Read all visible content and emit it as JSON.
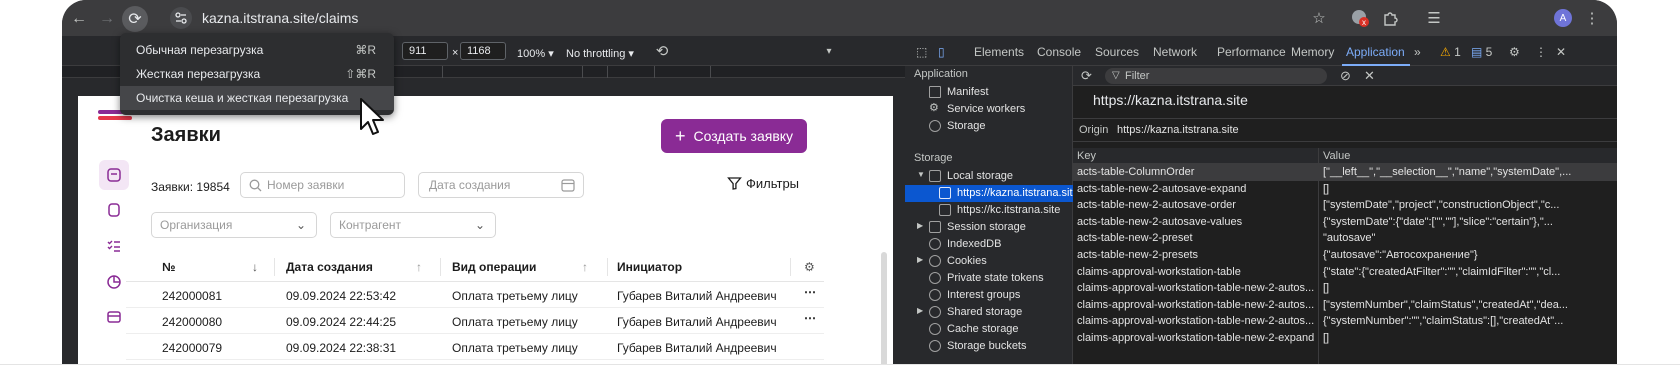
{
  "browser": {
    "url": "kazna.itstrana.site/claims",
    "avatar_letter": "A",
    "badge_count": "x"
  },
  "device_toolbar": {
    "width": "911",
    "times": "×",
    "height": "1168",
    "zoom": "100%",
    "throttling": "No throttling"
  },
  "reload_menu": {
    "items": [
      {
        "label": "Обычная перезагрузка",
        "shortcut": "⌘R"
      },
      {
        "label": "Жесткая перезагрузка",
        "shortcut": "⇧⌘R"
      },
      {
        "label": "Очистка кеша и жесткая перезагрузка",
        "shortcut": ""
      }
    ]
  },
  "page": {
    "title": "Заявки",
    "create_button": "Создать заявку",
    "create_plus": "+",
    "count_label": "Заявки: 19854",
    "search_placeholder": "Номер заявки",
    "date_placeholder": "Дата создания",
    "filters_label": "Фильтры",
    "org_placeholder": "Организация",
    "contractor_placeholder": "Контрагент",
    "columns": [
      "№",
      "Дата создания",
      "Вид операции",
      "Инициатор"
    ],
    "rows": [
      {
        "num": "242000081",
        "date": "09.09.2024 22:53:42",
        "op": "Оплата третьему лицу",
        "initiator": "Губарев Виталий Андреевич"
      },
      {
        "num": "242000080",
        "date": "09.09.2024 22:44:25",
        "op": "Оплата третьему лицу",
        "initiator": "Губарев Виталий Андреевич"
      },
      {
        "num": "242000079",
        "date": "09.09.2024 22:38:31",
        "op": "Оплата третьему лицу",
        "initiator": "Губарев Виталий Андреевич"
      }
    ]
  },
  "devtools": {
    "tabs": [
      "Elements",
      "Console",
      "Sources",
      "Network",
      "Performance",
      "Memory",
      "Application"
    ],
    "more": "»",
    "warn_count": "1",
    "msg_count": "5",
    "application_title": "Application",
    "app_items": [
      "Manifest",
      "Service workers",
      "Storage"
    ],
    "storage_title": "Storage",
    "storage_items": [
      "Local storage",
      "https://kazna.itstrana.site",
      "https://kc.itstrana.site",
      "Session storage",
      "IndexedDB",
      "Cookies",
      "Private state tokens",
      "Interest groups",
      "Shared storage",
      "Cache storage",
      "Storage buckets"
    ],
    "filter_placeholder": "Filter",
    "origin_heading": "https://kazna.itstrana.site",
    "origin_label": "Origin",
    "origin_value": "https://kazna.itstrana.site",
    "key_header": "Key",
    "value_header": "Value",
    "entries": [
      {
        "key": "acts-table-ColumnOrder",
        "value": "[\"__left__\",\"__selection__\",\"name\",\"systemDate\",..."
      },
      {
        "key": "acts-table-new-2-autosave-expand",
        "value": "[]"
      },
      {
        "key": "acts-table-new-2-autosave-order",
        "value": "[\"systemDate\",\"project\",\"constructionObject\",\"c..."
      },
      {
        "key": "acts-table-new-2-autosave-values",
        "value": "{\"systemDate\":{\"date\":[\"\",\"\"],\"slice\":\"certain\"},\"..."
      },
      {
        "key": "acts-table-new-2-preset",
        "value": "\"autosave\""
      },
      {
        "key": "acts-table-new-2-presets",
        "value": "{\"autosave\":\"Автосохранение\"}"
      },
      {
        "key": "claims-approval-workstation-table",
        "value": "{\"state\":{\"createdAtFilter\":\"\",\"claimIdFilter\":\"\",\"cl..."
      },
      {
        "key": "claims-approval-workstation-table-new-2-autos...",
        "value": "[]"
      },
      {
        "key": "claims-approval-workstation-table-new-2-autos...",
        "value": "[\"systemNumber\",\"claimStatus\",\"createdAt\",\"dea..."
      },
      {
        "key": "claims-approval-workstation-table-new-2-autos...",
        "value": "{\"systemNumber\":\"\",\"claimStatus\":[],\"createdAt\"..."
      },
      {
        "key": "claims-approval-workstation-table-new-2-expand",
        "value": "[]"
      }
    ]
  }
}
